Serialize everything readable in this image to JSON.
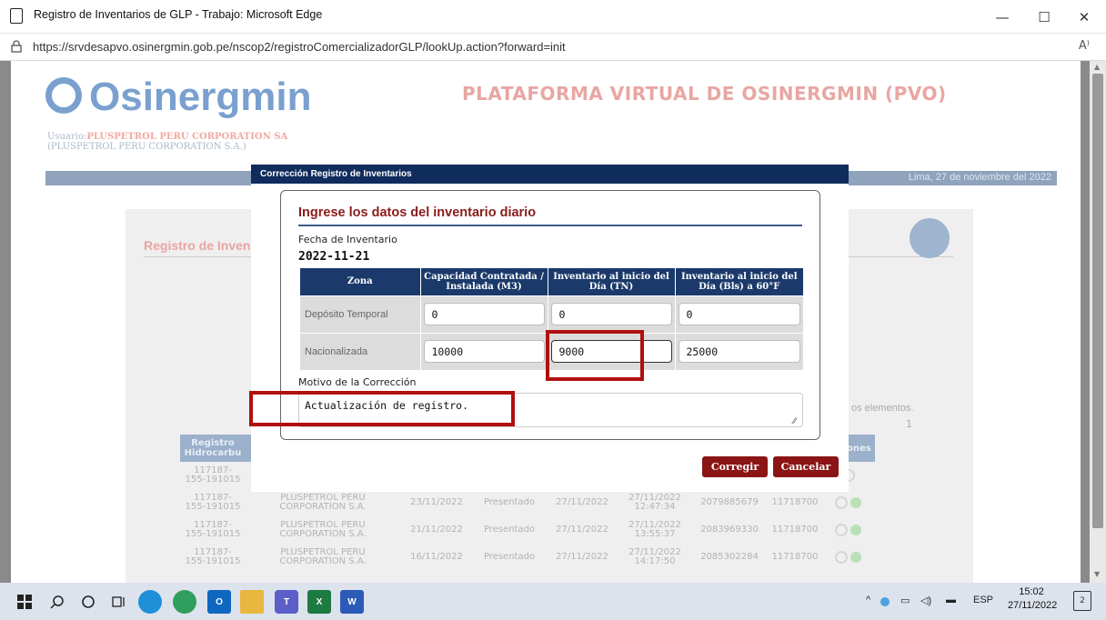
{
  "window": {
    "title": "Registro de Inventarios de GLP - Trabajo: Microsoft Edge",
    "minimize": "—",
    "maximize": "☐",
    "close": "✕"
  },
  "address": {
    "url": "https://srvdesapvo.osinergmin.gob.pe/nscop2/registroComercializadorGLP/lookUp.action?forward=init",
    "read_aloud": "A⁾"
  },
  "header": {
    "logo": "Osinergmin",
    "platform": "PLATAFORMA VIRTUAL DE OSINERGMIN (PVO)",
    "user_prefix": "Usuario:",
    "user_name": "PLUSPETROL PERU CORPORATION SA",
    "user_company": "(PLUSPETROL PERU CORPORATION S.A.)",
    "date": "Lima, 27 de noviembre del 2022"
  },
  "panel": {
    "title": "Registro de Inven",
    "elements": "os elementos.",
    "page": "1"
  },
  "background_table": {
    "headers": [
      "Registro Hidrocarbu",
      "",
      "",
      "",
      "",
      "",
      "",
      "n",
      "Acciones"
    ],
    "rows": [
      [
        "117187-155-191015",
        "",
        "",
        "",
        "",
        "",
        "",
        ""
      ],
      [
        "117187-155-191015",
        "PLUSPETROL PERU CORPORATION S.A.",
        "23/11/2022",
        "Presentado",
        "27/11/2022",
        "27/11/2022 12:47:34",
        "2079885679",
        "11718700"
      ],
      [
        "117187-155-191015",
        "PLUSPETROL PERU CORPORATION S.A.",
        "21/11/2022",
        "Presentado",
        "27/11/2022",
        "27/11/2022 13:55:37",
        "2083969330",
        "11718700"
      ],
      [
        "117187-155-191015",
        "PLUSPETROL PERU CORPORATION S.A.",
        "16/11/2022",
        "Presentado",
        "27/11/2022",
        "27/11/2022 14:17:50",
        "2085302284",
        "11718700"
      ]
    ]
  },
  "modal": {
    "header": "Corrección Registro de Inventarios",
    "title": "Ingrese los datos del inventario diario",
    "date_label": "Fecha de Inventario",
    "date_value": "2022-11-21",
    "columns": [
      "Zona",
      "Capacidad Contratada / Instalada (M3)",
      "Inventario al inicio del Día (TN)",
      "Inventario al inicio del Día (Bls) a 60°F"
    ],
    "rows": [
      {
        "zone": "Depósito Temporal",
        "capacity": "0",
        "inv_tn": "0",
        "inv_bls": "0"
      },
      {
        "zone": "Nacionalizada",
        "capacity": "10000",
        "inv_tn": "9000",
        "inv_bls": "25000"
      }
    ],
    "motivo_label": "Motivo de la Corrección",
    "motivo_value": "Actualización de registro.",
    "btn_corregir": "Corregir",
    "btn_cancelar": "Cancelar"
  },
  "taskbar": {
    "apps": [
      "windows-start",
      "search",
      "cortana",
      "task-view",
      "edge",
      "chrome",
      "outlook",
      "file-explorer",
      "teams",
      "excel",
      "word"
    ],
    "lang": "ESP",
    "time": "15:02",
    "date": "27/11/2022",
    "notifications": "2"
  },
  "colors": {
    "modal_header": "#0f2c5c",
    "table_header": "#1b3a6b",
    "button": "#8b1414",
    "title": "#8b1b1b",
    "highlight": "#b00f0f"
  }
}
